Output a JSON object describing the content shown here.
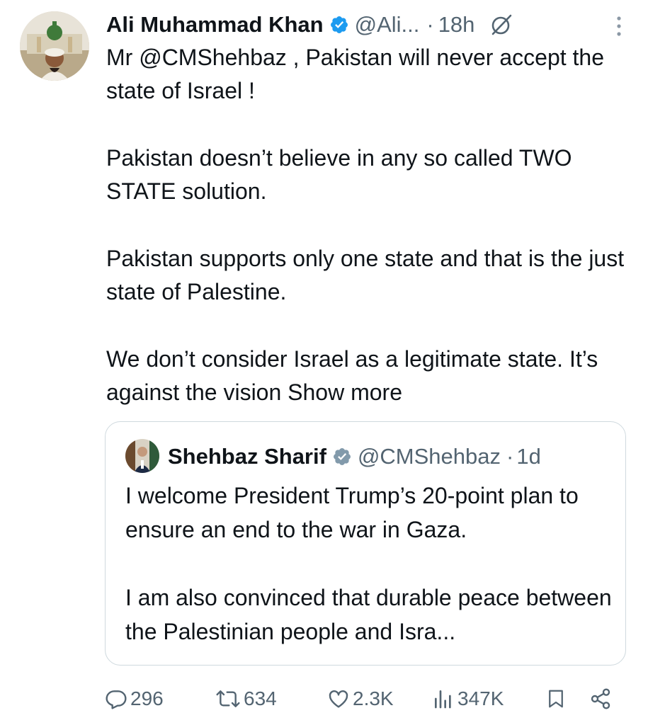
{
  "tweet": {
    "author_name": "Ali Muhammad Khan",
    "handle": "@Ali...",
    "separator": "·",
    "time": "18h",
    "paragraphs": [
      "Mr @CMShehbaz , Pakistan will never accept the state of Israel !",
      "Pakistan doesn’t  believe in any so called TWO STATE solution.",
      "Pakistan supports only one state and that is the just state of Palestine."
    ],
    "last_paragraph": "We don’t consider Israel as a legitimate state. It’s against the vision",
    "show_more": "Show more"
  },
  "quote": {
    "author_name": "Shehbaz Sharif",
    "handle": "@CMShehbaz",
    "separator": "·",
    "time": "1d",
    "paragraphs": [
      "I welcome President Trump’s 20-point plan to ensure an end to the war in Gaza.",
      "I am also convinced that durable peace between the Palestinian people and Isra..."
    ]
  },
  "actions": {
    "replies": "296",
    "reposts": "634",
    "likes": "2.3K",
    "views": "347K"
  },
  "icons": {
    "verified": "verified-badge-icon",
    "grok": "grok-icon",
    "more": "more-vertical-icon",
    "reply": "reply-icon",
    "repost": "repost-icon",
    "like": "heart-icon",
    "views": "views-icon",
    "bookmark": "bookmark-icon",
    "share": "share-icon"
  },
  "colors": {
    "text": "#0f1419",
    "secondary": "#536471",
    "verified": "#1d9bf0",
    "quote_verified": "#829aab",
    "border": "#cfd9de"
  }
}
